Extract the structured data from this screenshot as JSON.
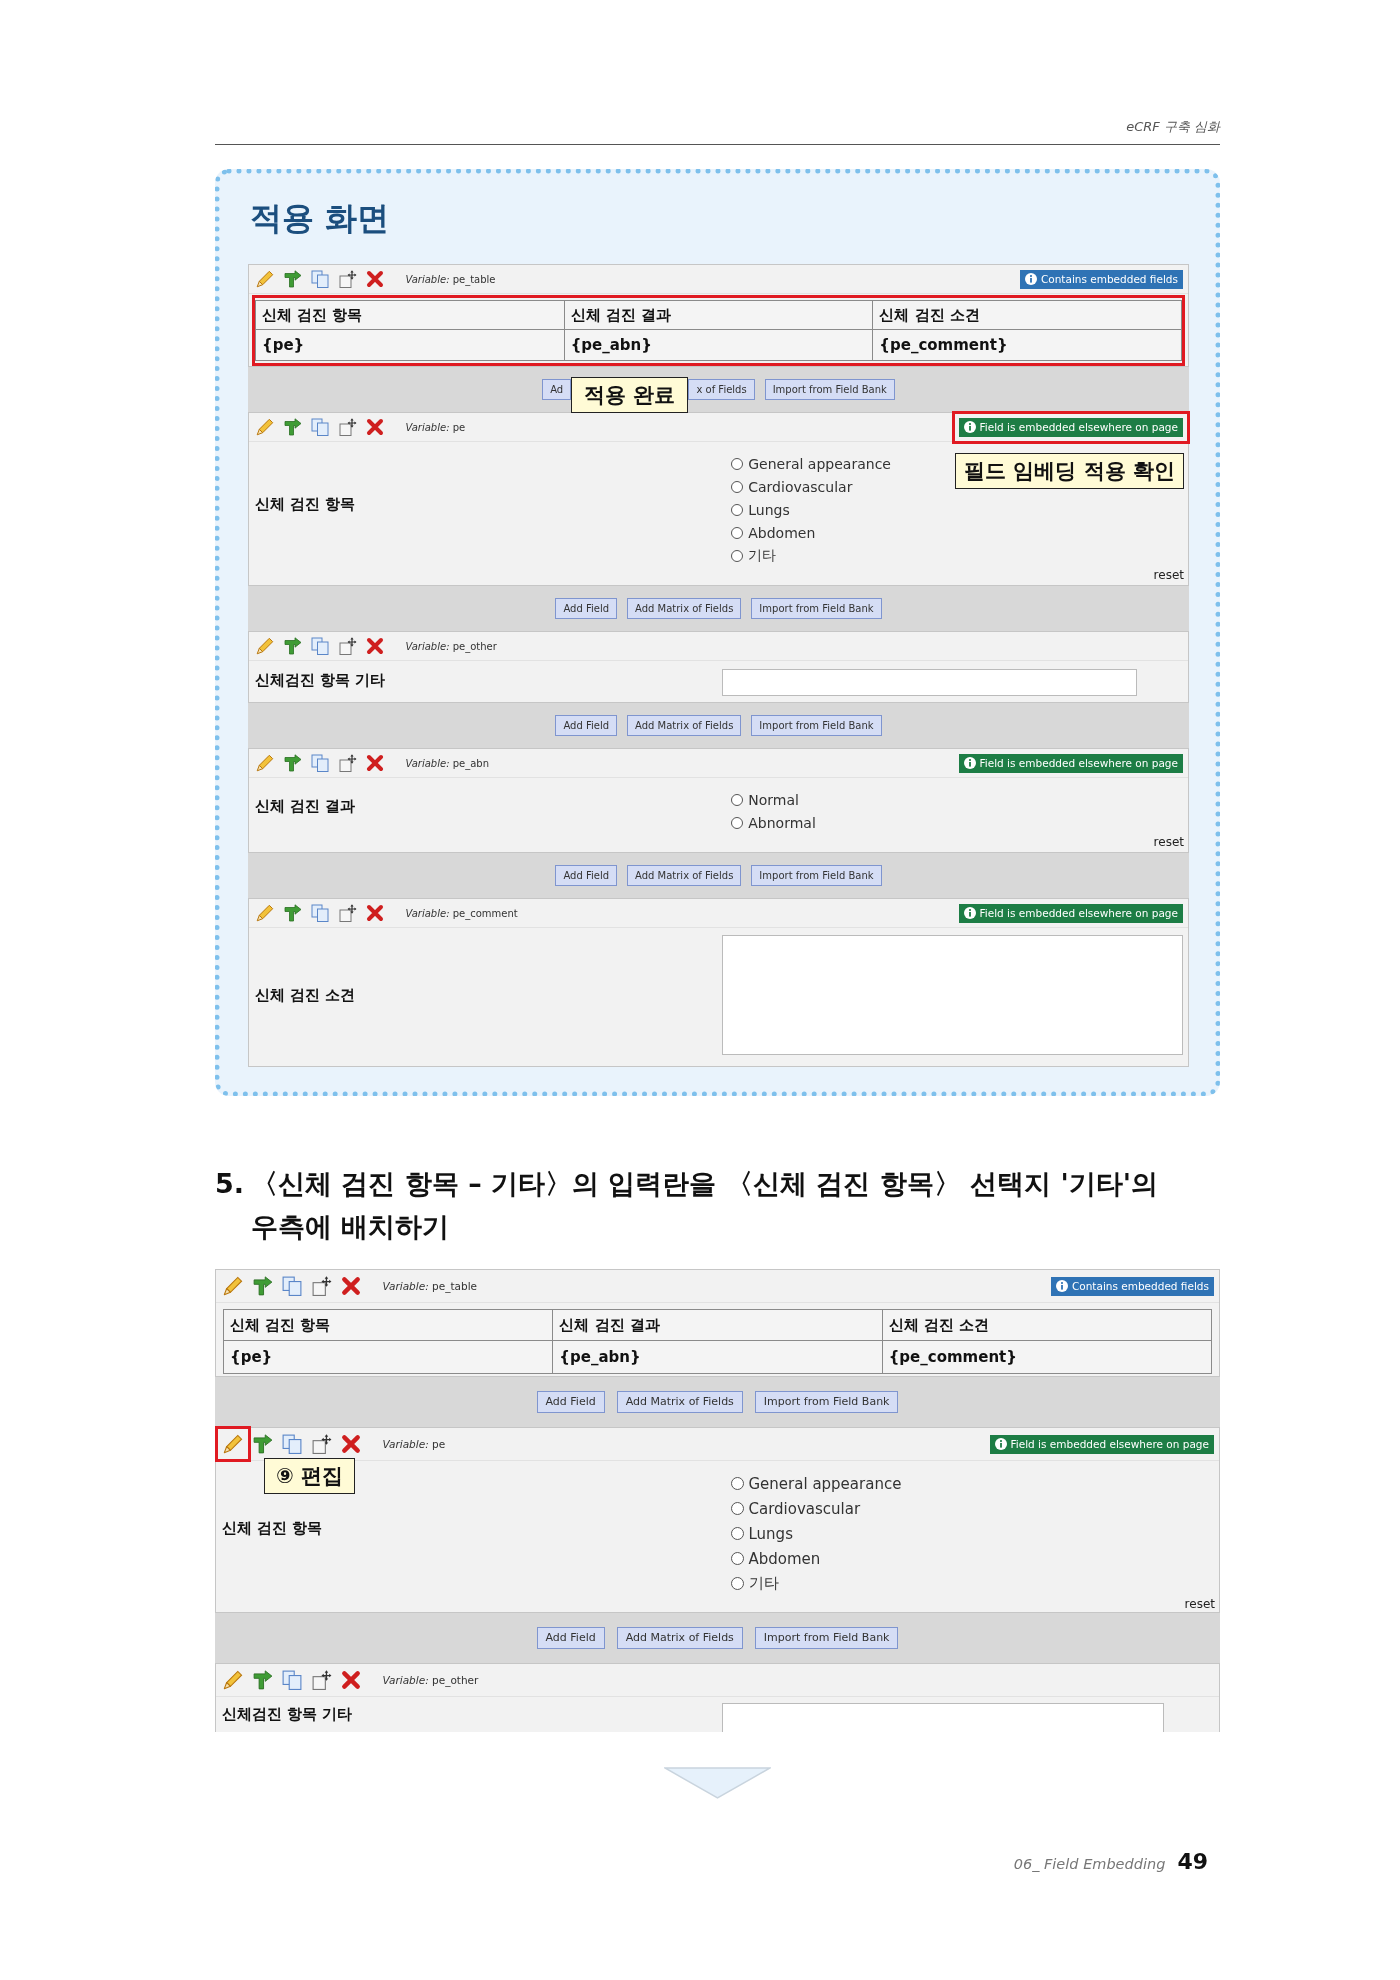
{
  "header": {
    "running_title": "eCRF 구축 심화"
  },
  "example": {
    "title": "적용 화면",
    "screen": {
      "cropped_bottom": false,
      "items": [
        {
          "kind": "table",
          "variable": "*Variable:* pe_table",
          "edit": {
            "highlighted": false
          },
          "badge": {
            "kind": "contains",
            "text": "Contains embedded fields",
            "highlighted": false
          },
          "table": {
            "highlighted": true,
            "columns": [
              "신체 검진 항목",
              "신체 검진 결과",
              "신체 검진 소견"
            ],
            "rows": [
              [
                "{pe}",
                "{pe_abn}",
                "{pe_comment}"
              ]
            ]
          }
        },
        {
          "kind": "buttons",
          "buttons": [
            {
              "kind": "button",
              "label": "Ad"
            },
            {
              "kind": "callout",
              "label": "적용 완료"
            },
            {
              "kind": "button",
              "label": "x of Fields"
            },
            {
              "kind": "button",
              "label": "Import from Field Bank"
            }
          ]
        },
        {
          "kind": "radio",
          "variable": "*Variable:* pe",
          "edit": {
            "highlighted": false
          },
          "badge": {
            "kind": "embedded",
            "text": "Field is embedded elsewhere on page",
            "highlighted": true,
            "note": "필드 임베딩 적용 확인"
          },
          "label": "신체 검진 항목",
          "options": [
            {
              "label": "General appearance",
              "selected": false
            },
            {
              "label": "Cardiovascular",
              "selected": false
            },
            {
              "label": "Lungs",
              "selected": false
            },
            {
              "label": "Abdomen",
              "selected": false
            },
            {
              "label": "기타",
              "selected": false
            }
          ],
          "reset": "reset"
        },
        {
          "kind": "buttons",
          "buttons": [
            {
              "kind": "button",
              "label": "Add Field"
            },
            {
              "kind": "button",
              "label": "Add Matrix of Fields"
            },
            {
              "kind": "button",
              "label": "Import from Field Bank"
            }
          ]
        },
        {
          "kind": "text",
          "variable": "*Variable:* pe_other",
          "edit": {
            "highlighted": false
          },
          "label": "신체검진 항목 기타"
        },
        {
          "kind": "buttons",
          "buttons": [
            {
              "kind": "button",
              "label": "Add Field"
            },
            {
              "kind": "button",
              "label": "Add Matrix of Fields"
            },
            {
              "kind": "button",
              "label": "Import from Field Bank"
            }
          ]
        },
        {
          "kind": "radio",
          "variable": "*Variable:* pe_abn",
          "edit": {
            "highlighted": false
          },
          "badge": {
            "kind": "embedded",
            "text": "Field is embedded elsewhere on page",
            "highlighted": false
          },
          "label": "신체 검진 결과",
          "options": [
            {
              "label": "Normal",
              "selected": false
            },
            {
              "label": "Abnormal",
              "selected": false
            }
          ],
          "reset": "reset"
        },
        {
          "kind": "buttons",
          "buttons": [
            {
              "kind": "button",
              "label": "Add Field"
            },
            {
              "kind": "button",
              "label": "Add Matrix of Fields"
            },
            {
              "kind": "button",
              "label": "Import from Field Bank"
            }
          ]
        },
        {
          "kind": "textarea",
          "variable": "*Variable:* pe_comment",
          "edit": {
            "highlighted": false
          },
          "badge": {
            "kind": "embedded",
            "text": "Field is embedded elsewhere on page",
            "highlighted": false
          },
          "label": "신체 검진 소견"
        }
      ]
    }
  },
  "step": {
    "number": "5.",
    "title": "〈신체 검진 항목 – 기타〉의 입력란을 〈신체 검진 항목〉 선택지 '기타'의 우측에 배치하기"
  },
  "screen": {
    "cropped_bottom": true,
    "items": [
      {
        "kind": "table",
        "variable": "*Variable:* pe_table",
        "edit": {
          "highlighted": false
        },
        "badge": {
          "kind": "contains",
          "text": "Contains embedded fields",
          "highlighted": false
        },
        "table": {
          "highlighted": false,
          "columns": [
            "신체 검진 항목",
            "신체 검진 결과",
            "신체 검진 소견"
          ],
          "rows": [
            [
              "{pe}",
              "{pe_abn}",
              "{pe_comment}"
            ]
          ]
        }
      },
      {
        "kind": "buttons",
        "buttons": [
          {
            "kind": "button",
            "label": "Add Field"
          },
          {
            "kind": "button",
            "label": "Add Matrix of Fields"
          },
          {
            "kind": "button",
            "label": "Import from Field Bank"
          }
        ]
      },
      {
        "kind": "radio",
        "variable": "*Variable:* pe",
        "edit": {
          "highlighted": true,
          "note": "⑨ 편집"
        },
        "badge": {
          "kind": "embedded",
          "text": "Field is embedded elsewhere on page",
          "highlighted": false
        },
        "label": "신체 검진 항목",
        "options": [
          {
            "label": "General appearance",
            "selected": false
          },
          {
            "label": "Cardiovascular",
            "selected": false
          },
          {
            "label": "Lungs",
            "selected": false
          },
          {
            "label": "Abdomen",
            "selected": false
          },
          {
            "label": "기타",
            "selected": false
          }
        ],
        "reset": "reset"
      },
      {
        "kind": "buttons",
        "buttons": [
          {
            "kind": "button",
            "label": "Add Field"
          },
          {
            "kind": "button",
            "label": "Add Matrix of Fields"
          },
          {
            "kind": "button",
            "label": "Import from Field Bank"
          }
        ]
      },
      {
        "kind": "text",
        "variable": "*Variable:* pe_other",
        "edit": {
          "highlighted": false
        },
        "label": "신체검진 항목 기타"
      }
    ]
  },
  "footer": {
    "chapter": "06_ Field Embedding",
    "page": "49"
  }
}
